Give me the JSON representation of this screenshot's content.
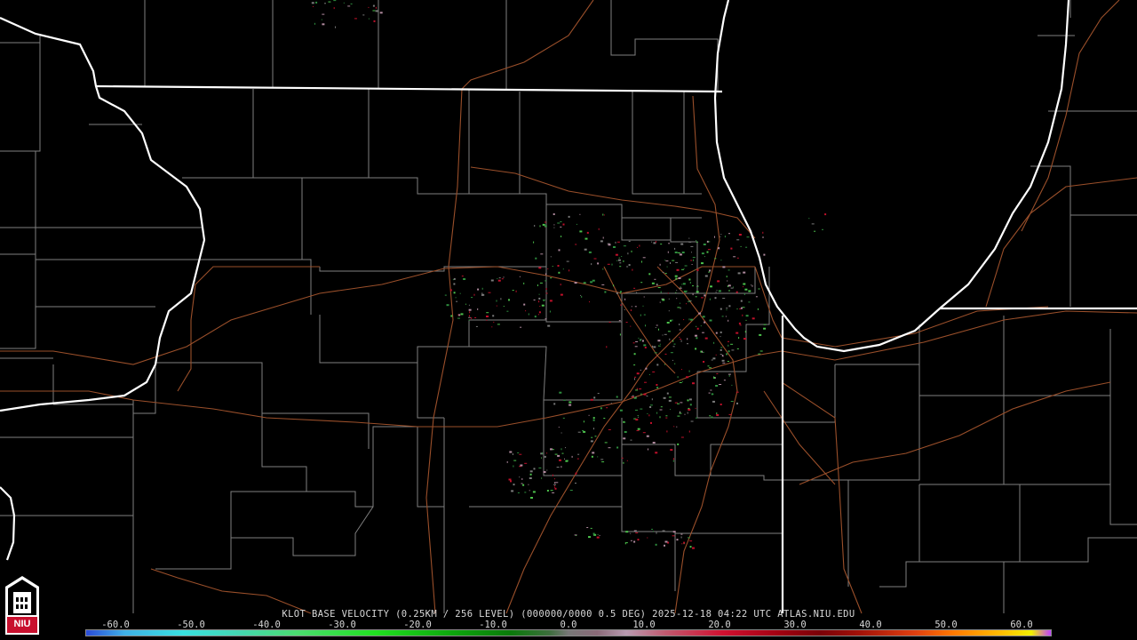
{
  "product": {
    "caption": "KLOT BASE VELOCITY (0.25KM / 256 LEVEL) (000000/0000 0.5 DEG) 2025-12-18 04:22 UTC  ATLAS.NIU.EDU"
  },
  "colorbar": {
    "ticks": [
      "-60.0",
      "-50.0",
      "-40.0",
      "-30.0",
      "-20.0",
      "-10.0",
      "0.0",
      "10.0",
      "20.0",
      "30.0",
      "40.0",
      "50.0",
      "60.0"
    ],
    "range": [
      -64,
      64
    ]
  },
  "logo": {
    "text": "NIU"
  },
  "colors": {
    "state_border": "#ffffff",
    "shoreline": "#ffffff",
    "county_lines": "#808080",
    "highways": "#a0522d",
    "echo_green": "#2f8f3f",
    "echo_pink": "#b08a9e",
    "echo_red": "#c0102a"
  },
  "icons": {
    "logo": "niu-tower-logo"
  }
}
